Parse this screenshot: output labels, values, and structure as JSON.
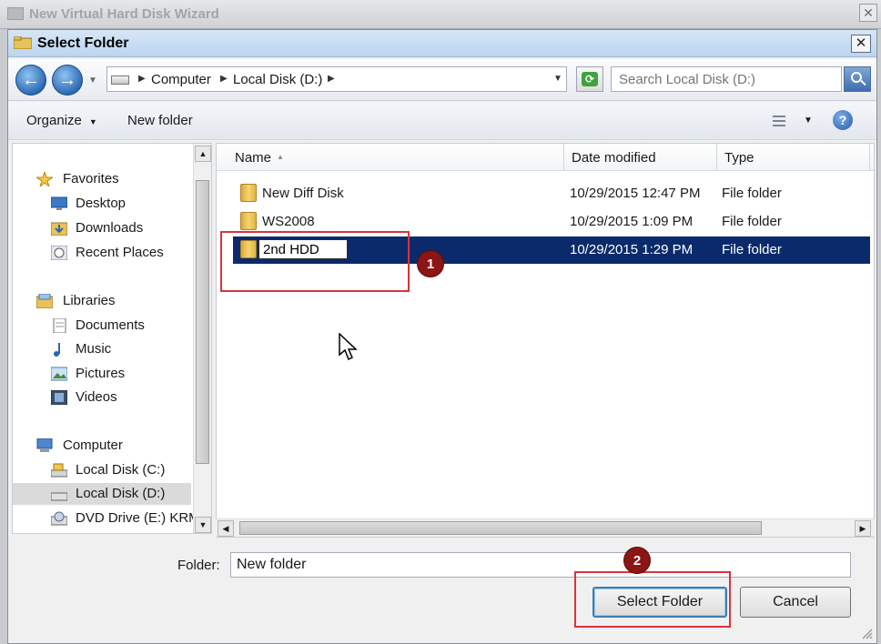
{
  "outer_window": {
    "title": "New Virtual Hard Disk Wizard",
    "close_label": "✕"
  },
  "dialog": {
    "title": "Select Folder",
    "close_label": "✕",
    "nav": {
      "back": "←",
      "forward": "→",
      "breadcrumb": [
        "Computer",
        "Local Disk (D:)"
      ],
      "refresh": "⟳"
    },
    "search": {
      "placeholder": "Search Local Disk (D:)"
    },
    "toolbar": {
      "organize": "Organize",
      "new_folder": "New folder",
      "help": "?"
    },
    "sidebar": {
      "favorites": {
        "label": "Favorites",
        "items": [
          "Desktop",
          "Downloads",
          "Recent Places"
        ]
      },
      "libraries": {
        "label": "Libraries",
        "items": [
          "Documents",
          "Music",
          "Pictures",
          "Videos"
        ]
      },
      "computer": {
        "label": "Computer",
        "items": [
          "Local Disk (C:)",
          "Local Disk (D:)",
          "DVD Drive (E:) KRM"
        ]
      },
      "selected": "Local Disk (D:)"
    },
    "columns": [
      "Name",
      "Date modified",
      "Type"
    ],
    "files": [
      {
        "name": "New Diff Disk",
        "date": "10/29/2015 12:47 PM",
        "type": "File folder"
      },
      {
        "name": "WS2008",
        "date": "10/29/2015 1:09 PM",
        "type": "File folder"
      },
      {
        "name": "2nd HDD",
        "date": "10/29/2015 1:29 PM",
        "type": "File folder",
        "selected": true,
        "renaming": true
      }
    ],
    "folder_label": "Folder:",
    "folder_value": "New folder",
    "buttons": {
      "select": "Select Folder",
      "cancel": "Cancel"
    }
  },
  "annotations": [
    {
      "number": "1"
    },
    {
      "number": "2"
    }
  ],
  "colors": {
    "selection": "#0b2a6b",
    "highlight_box": "#d9343a",
    "badge": "#8c1515"
  }
}
